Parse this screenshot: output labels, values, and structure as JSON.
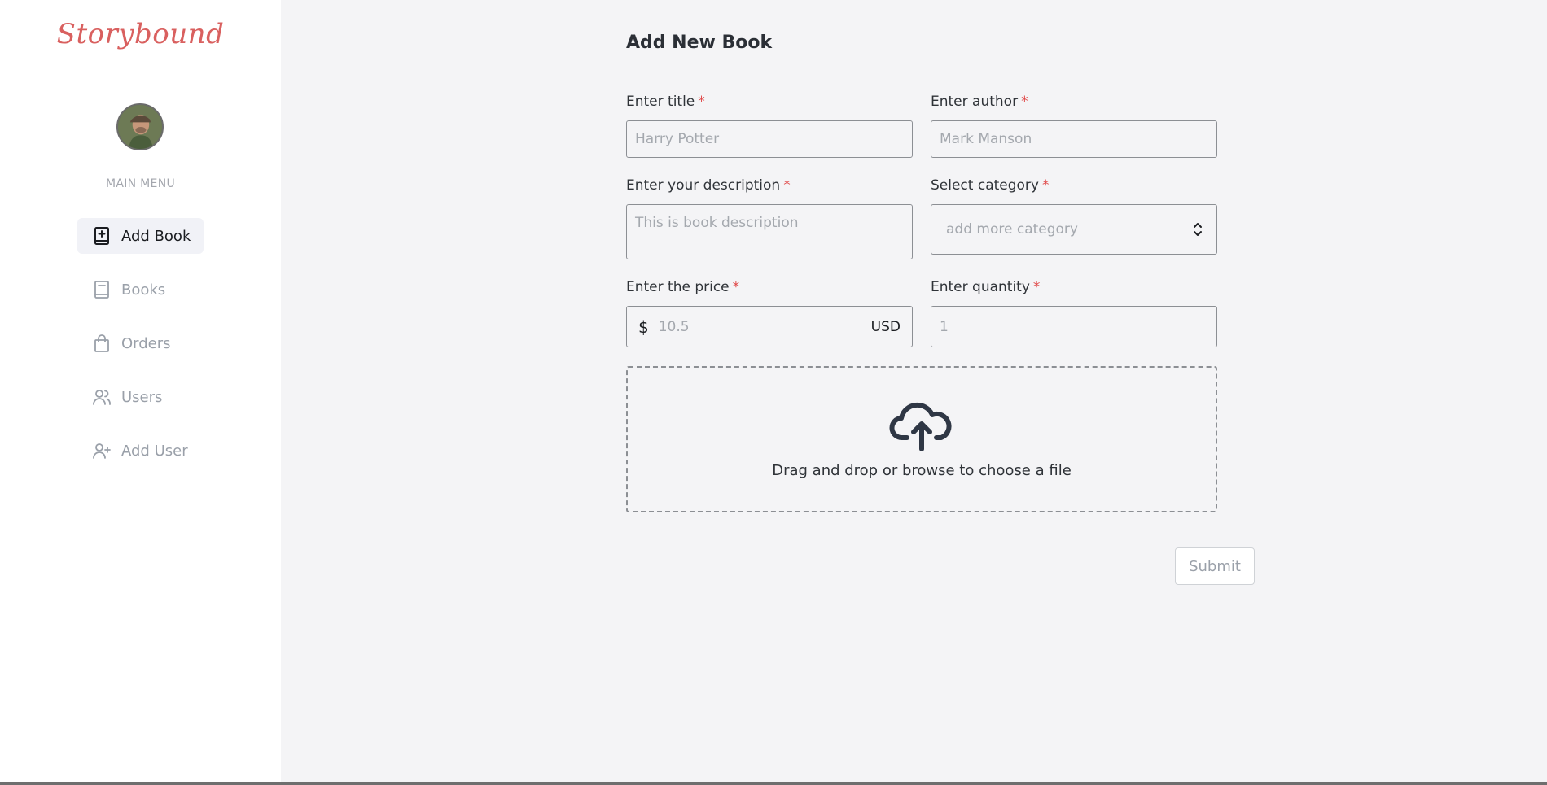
{
  "brand": {
    "name": "Storybound"
  },
  "sidebar": {
    "menu_heading": "MAIN MENU",
    "items": [
      {
        "label": "Add Book",
        "icon": "add-book-icon",
        "active": true
      },
      {
        "label": "Books",
        "icon": "book-icon",
        "active": false
      },
      {
        "label": "Orders",
        "icon": "shopping-bag-icon",
        "active": false
      },
      {
        "label": "Users",
        "icon": "users-icon",
        "active": false
      },
      {
        "label": "Add User",
        "icon": "add-user-icon",
        "active": false
      }
    ]
  },
  "form": {
    "title": "Add New Book",
    "required_marker": "*",
    "title_field": {
      "label": "Enter title",
      "placeholder": "Harry Potter"
    },
    "author_field": {
      "label": "Enter author",
      "placeholder": "Mark Manson"
    },
    "description_field": {
      "label": "Enter your description",
      "placeholder": "This is book description"
    },
    "category_field": {
      "label": "Select category",
      "placeholder": "add more category"
    },
    "price_field": {
      "label": "Enter the price",
      "placeholder": "10.5",
      "symbol": "$",
      "currency": "USD"
    },
    "quantity_field": {
      "label": "Enter quantity",
      "placeholder": "1"
    },
    "dropzone": {
      "text": "Drag and drop or browse to choose a file",
      "icon": "cloud-upload-icon"
    },
    "submit_label": "Submit"
  },
  "colors": {
    "brand": "#d9605f",
    "required": "#e04848",
    "active_bg": "#f1f2f7"
  }
}
